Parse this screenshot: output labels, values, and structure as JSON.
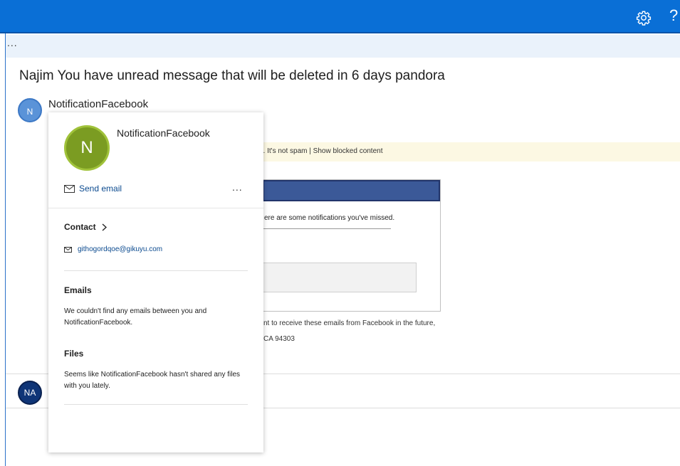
{
  "topbar": {
    "settings_icon": "gear-icon",
    "help_label": "?"
  },
  "command_bar": {
    "more_label": "..."
  },
  "message": {
    "subject": "Najim You have unread message that will be deleted in 6 days pandora",
    "sender_initial": "N",
    "sender_name": "NotificationFacebook",
    "banner_text": "ays. It's not spam | Show blocked content",
    "body_missed": "ere are some notifications you've missed.",
    "footer_line1": "nt to receive these emails from Facebook in the future,",
    "footer_line2": "CA 94303",
    "second_avatar_initials": "NA",
    "colors": {
      "topbar": "#0a6fd6",
      "facebook_header": "#3b5998",
      "banner": "#fcf8e3"
    }
  },
  "contact_card": {
    "initial": "N",
    "name": "NotificationFacebook",
    "send_email_label": "Send email",
    "more_label": "...",
    "contact_title": "Contact",
    "email": "githogordqoe@gikuyu.com",
    "emails_title": "Emails",
    "emails_text": "We couldn't find any emails between you and NotificationFacebook.",
    "files_title": "Files",
    "files_text": "Seems like NotificationFacebook hasn't shared any files with you lately.",
    "avatar_color": "#7b9c22"
  }
}
